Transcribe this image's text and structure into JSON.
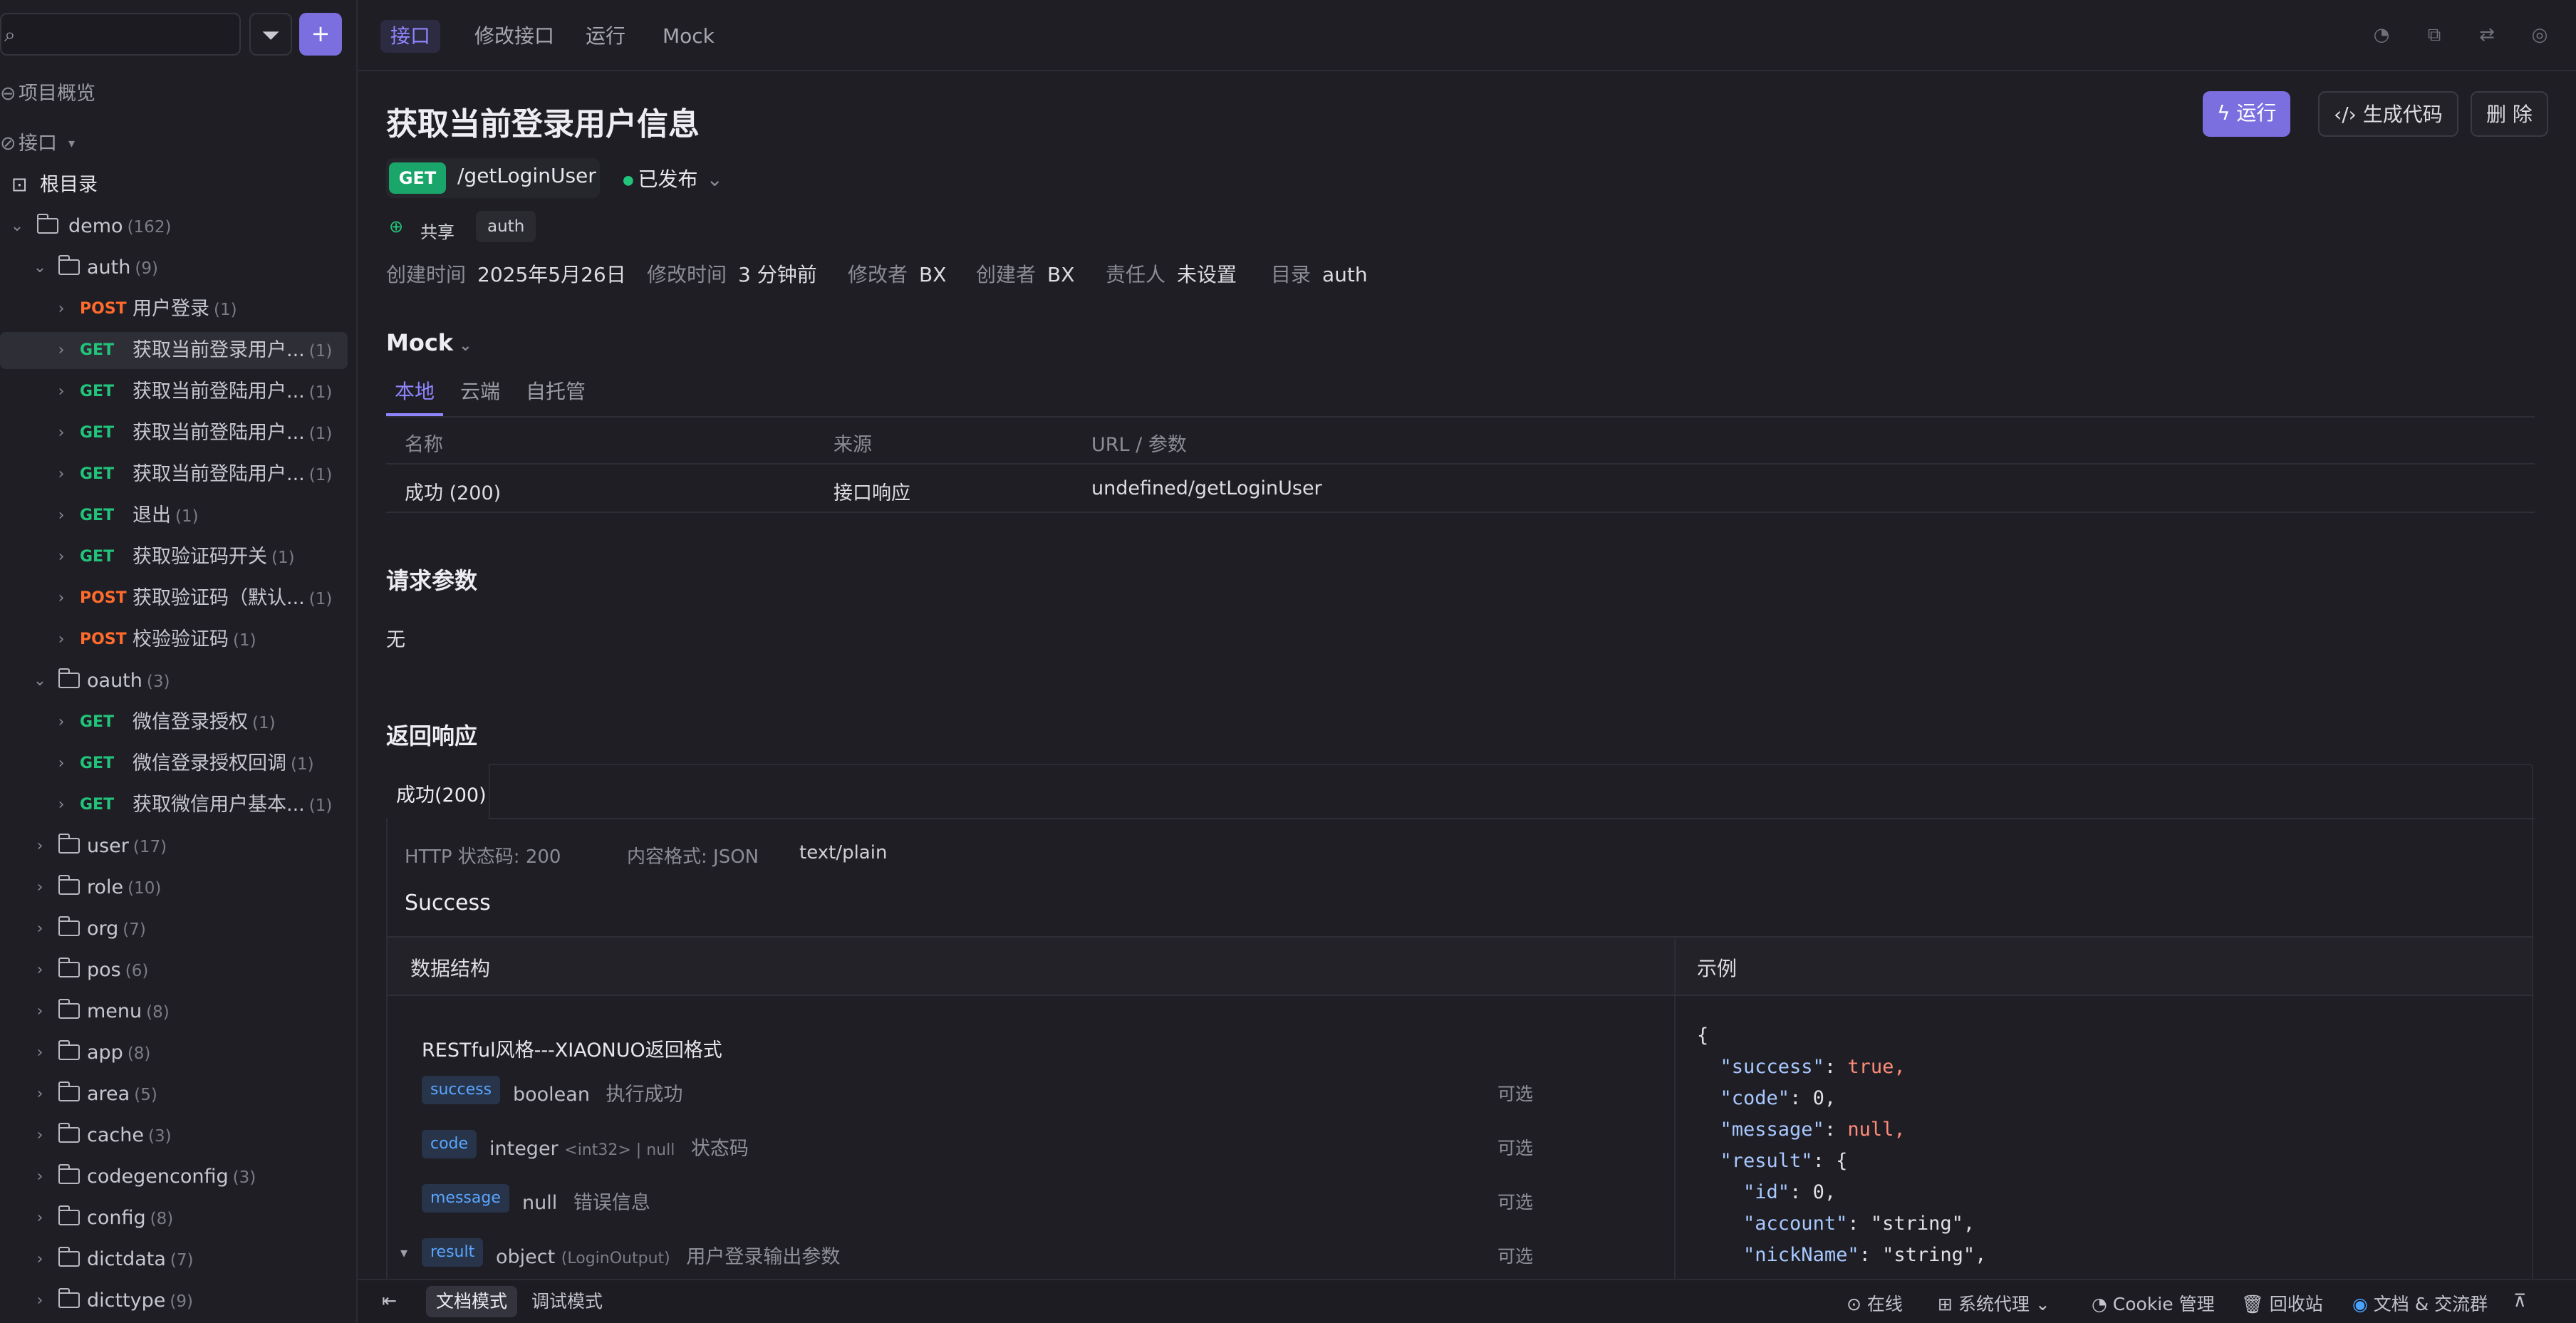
{
  "search": {
    "placeholder": ""
  },
  "sidebar": {
    "overview": "项目概览",
    "api": "接口",
    "root": "根目录",
    "demo": {
      "name": "demo",
      "count": "(162)"
    },
    "auth": {
      "name": "auth",
      "count": "(9)"
    },
    "auth_items": [
      {
        "method": "POST",
        "label": "用户登录",
        "count": "(1)"
      },
      {
        "method": "GET",
        "label": "获取当前登录用户...",
        "count": "(1)"
      },
      {
        "method": "GET",
        "label": "获取当前登陆用户...",
        "count": "(1)"
      },
      {
        "method": "GET",
        "label": "获取当前登陆用户...",
        "count": "(1)"
      },
      {
        "method": "GET",
        "label": "获取当前登陆用户...",
        "count": "(1)"
      },
      {
        "method": "GET",
        "label": "退出",
        "count": "(1)"
      },
      {
        "method": "GET",
        "label": "获取验证码开关",
        "count": "(1)"
      },
      {
        "method": "POST",
        "label": "获取验证码（默认...",
        "count": "(1)"
      },
      {
        "method": "POST",
        "label": "校验验证码",
        "count": "(1)"
      }
    ],
    "oauth": {
      "name": "oauth",
      "count": "(3)"
    },
    "oauth_items": [
      {
        "method": "GET",
        "label": "微信登录授权",
        "count": "(1)"
      },
      {
        "method": "GET",
        "label": "微信登录授权回调",
        "count": "(1)"
      },
      {
        "method": "GET",
        "label": "获取微信用户基本...",
        "count": "(1)"
      }
    ],
    "folders": [
      {
        "name": "user",
        "count": "(17)"
      },
      {
        "name": "role",
        "count": "(10)"
      },
      {
        "name": "org",
        "count": "(7)"
      },
      {
        "name": "pos",
        "count": "(6)"
      },
      {
        "name": "menu",
        "count": "(8)"
      },
      {
        "name": "app",
        "count": "(8)"
      },
      {
        "name": "area",
        "count": "(5)"
      },
      {
        "name": "cache",
        "count": "(3)"
      },
      {
        "name": "codegenconfig",
        "count": "(3)"
      },
      {
        "name": "config",
        "count": "(8)"
      },
      {
        "name": "dictdata",
        "count": "(7)"
      },
      {
        "name": "dicttype",
        "count": "(9)"
      }
    ]
  },
  "tabs": [
    "接口",
    "修改接口",
    "运行",
    "Mock"
  ],
  "header": {
    "title": "获取当前登录用户信息",
    "method": "GET",
    "path": "/getLoginUser",
    "status": "已发布",
    "share": "共享",
    "tag": "auth",
    "run": "运行",
    "gen_code": "生成代码",
    "delete": "删 除"
  },
  "meta": [
    {
      "k": "创建时间",
      "v": "2025年5月26日"
    },
    {
      "k": "修改时间",
      "v": "3 分钟前"
    },
    {
      "k": "修改者",
      "v": "BX"
    },
    {
      "k": "创建者",
      "v": "BX"
    },
    {
      "k": "责任人",
      "v": "未设置"
    },
    {
      "k": "目录",
      "v": "auth"
    }
  ],
  "mock": {
    "title": "Mock",
    "tabs": [
      "本地",
      "云端",
      "自托管"
    ],
    "headers": [
      "名称",
      "来源",
      "URL / 参数"
    ],
    "row": [
      "成功 (200)",
      "接口响应",
      "undefined/getLoginUser"
    ]
  },
  "request": {
    "title": "请求参数",
    "none": "无"
  },
  "response": {
    "title": "返回响应",
    "tab": "成功(200)",
    "http_status": "HTTP 状态码: 200",
    "content_type": "内容格式: JSON",
    "mime": "text/plain",
    "desc": "Success",
    "struct_title": "数据结构",
    "example_title": "示例",
    "schema_name": "RESTful风格---XIAONUO返回格式",
    "fields": [
      {
        "name": "success",
        "type": "boolean",
        "fmt": "",
        "desc": "执行成功",
        "opt": "可选"
      },
      {
        "name": "code",
        "type": "integer",
        "fmt": "<int32> | null",
        "desc": "状态码",
        "opt": "可选"
      },
      {
        "name": "message",
        "type": "null",
        "fmt": "",
        "desc": "错误信息",
        "opt": "可选"
      },
      {
        "name": "result",
        "type": "object",
        "fmt": "(LoginOutput)",
        "desc": "用户登录输出参数",
        "opt": "可选"
      }
    ]
  },
  "example": {
    "lines": [
      "{",
      "  \"success\": true,",
      "  \"code\": 0,",
      "  \"message\": null,",
      "  \"result\": {",
      "    \"id\": 0,",
      "    \"account\": \"string\",",
      "    \"nickName\": \"string\","
    ]
  },
  "status_bar": {
    "doc_mode": "文档模式",
    "debug_mode": "调试模式",
    "online": "在线",
    "proxy": "系统代理",
    "cookie": "Cookie 管理",
    "recycle": "回收站",
    "docs": "文档 & 交流群"
  },
  "colors": {
    "accent": "#7b6fe0",
    "get": "#22c47b",
    "post": "#ff6b2c"
  }
}
